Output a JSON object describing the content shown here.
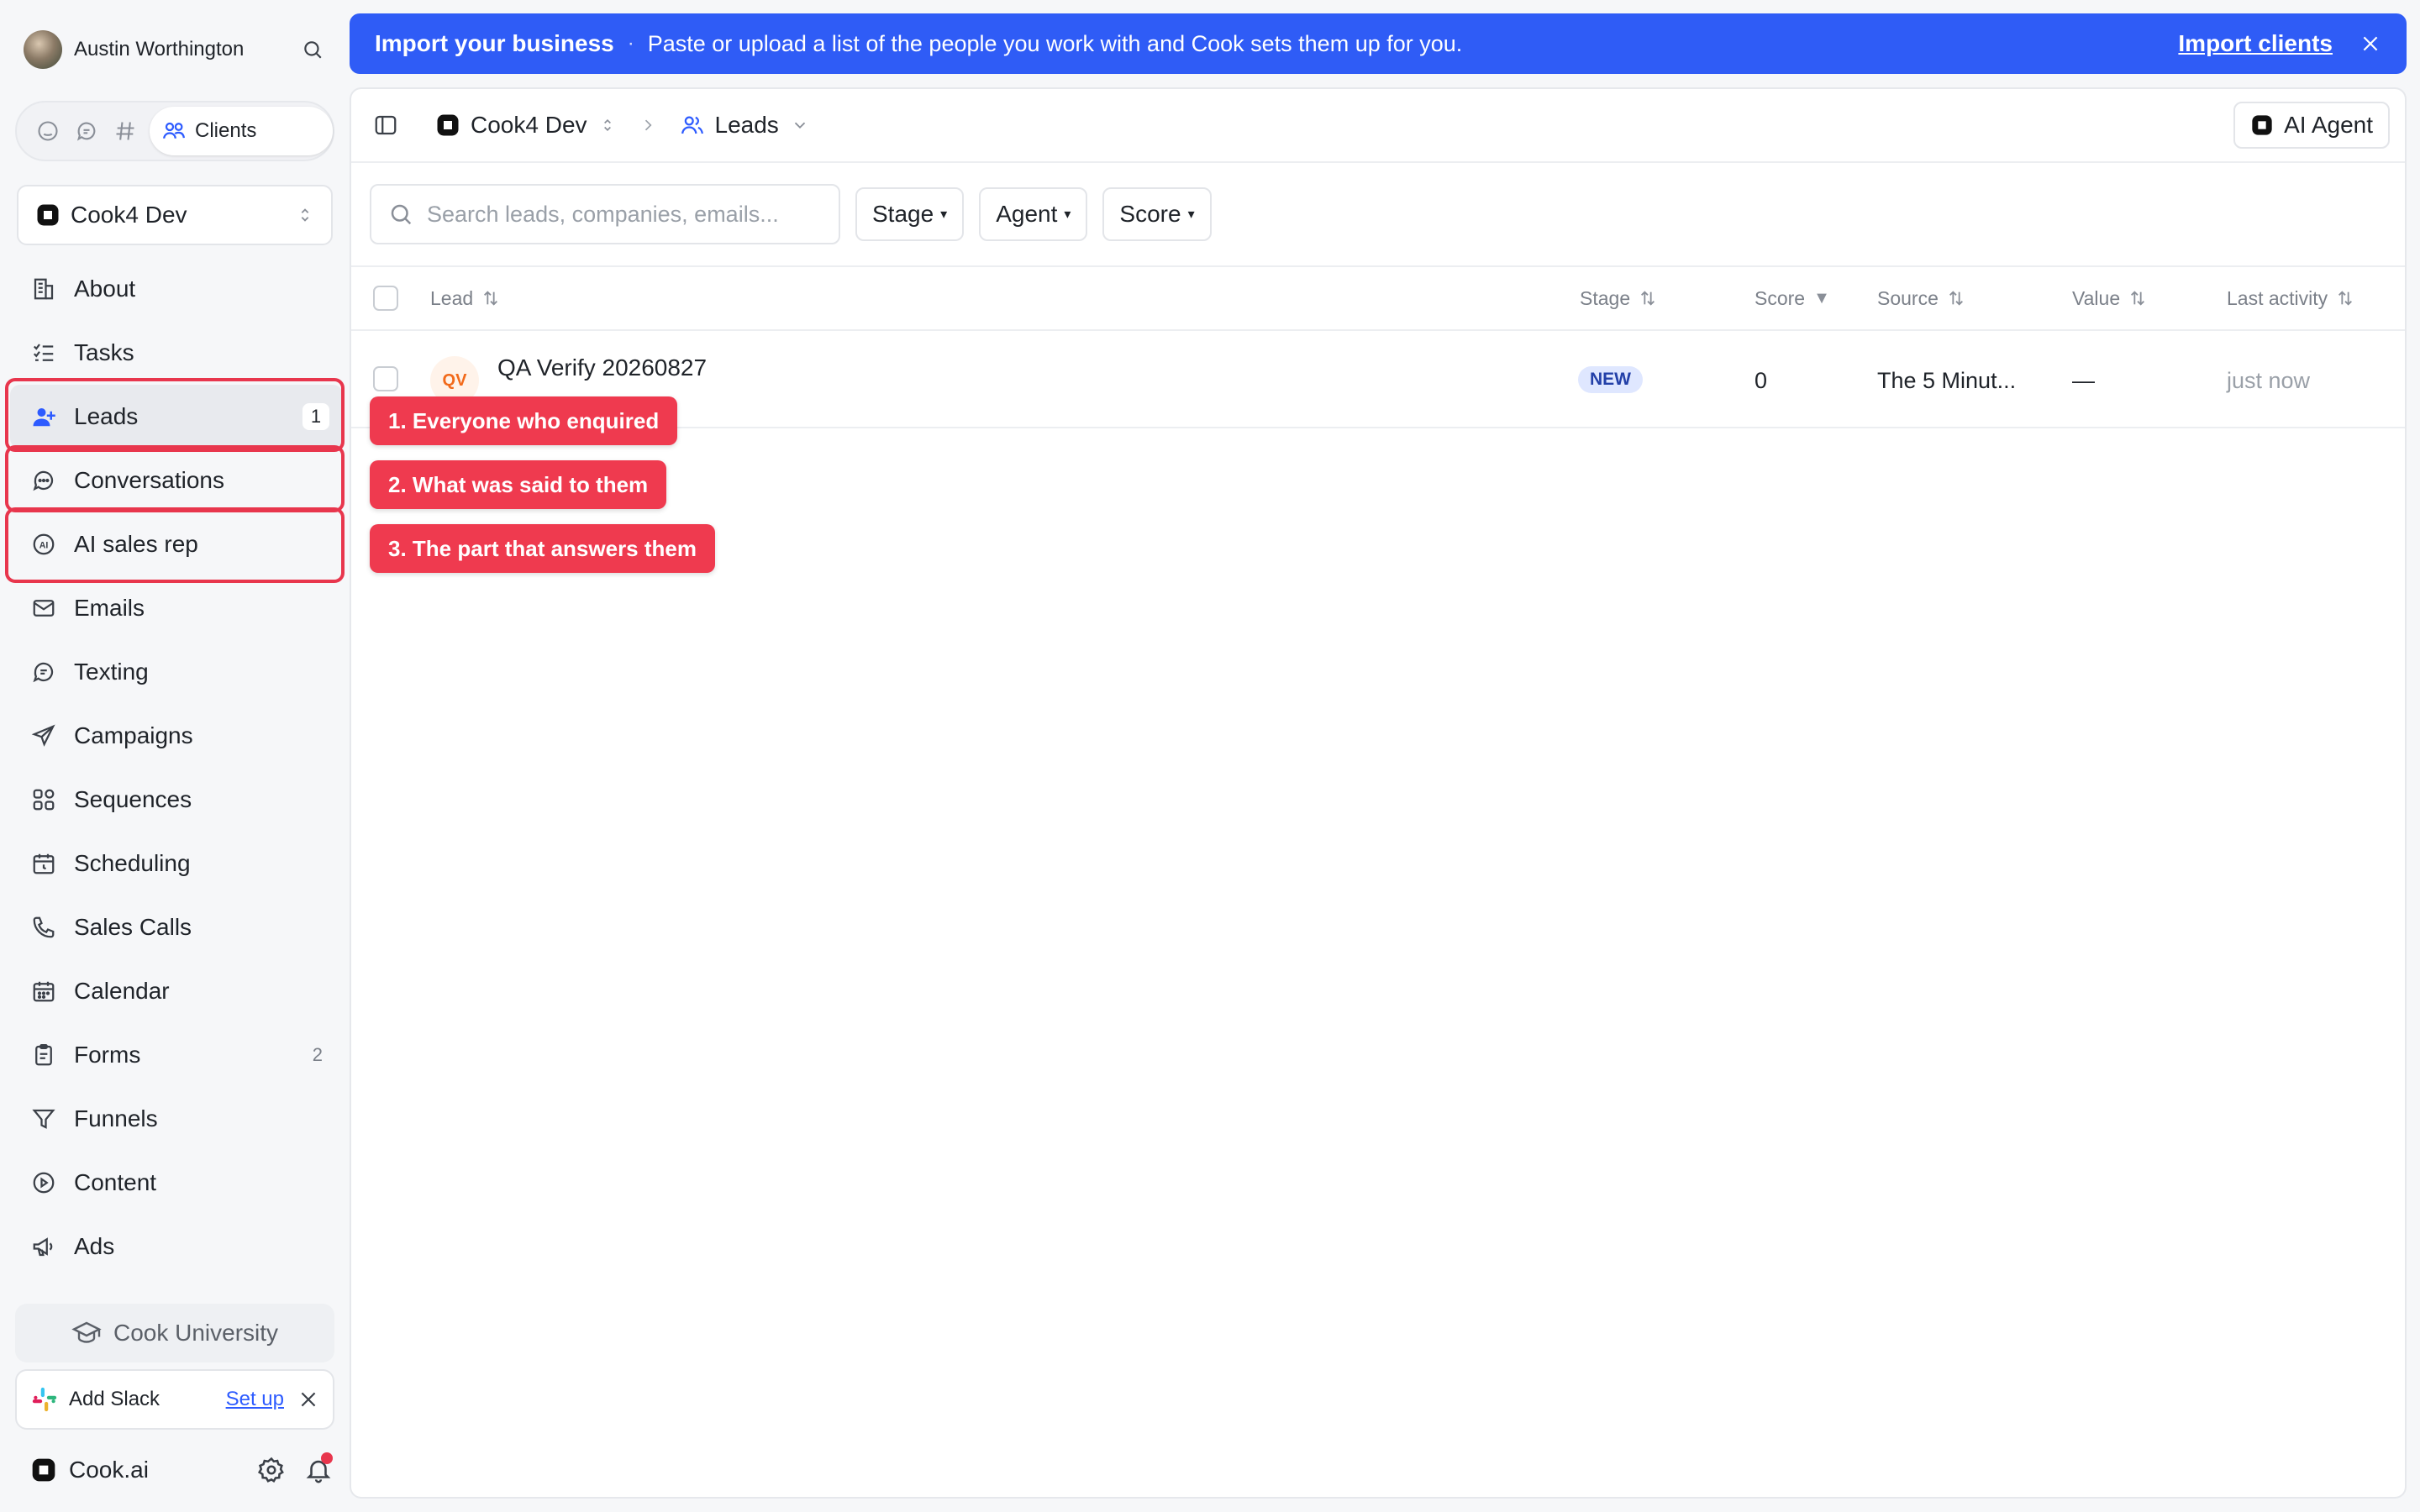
{
  "user": {
    "name": "Austin Worthington"
  },
  "mode_switch": {
    "active_label": "Clients"
  },
  "workspace": {
    "name": "Cook4 Dev"
  },
  "nav": {
    "items": [
      {
        "label": "About",
        "icon": "building-icon"
      },
      {
        "label": "Tasks",
        "icon": "checklist-icon"
      },
      {
        "label": "Leads",
        "icon": "person-plus-icon",
        "count": "1",
        "active": true
      },
      {
        "label": "Conversations",
        "icon": "chat-bubble-icon"
      },
      {
        "label": "AI sales rep",
        "icon": "ai-badge-icon"
      },
      {
        "label": "Emails",
        "icon": "mail-icon"
      },
      {
        "label": "Texting",
        "icon": "message-icon"
      },
      {
        "label": "Campaigns",
        "icon": "send-icon"
      },
      {
        "label": "Sequences",
        "icon": "grid-icon"
      },
      {
        "label": "Scheduling",
        "icon": "calendar-clock-icon"
      },
      {
        "label": "Sales Calls",
        "icon": "phone-icon"
      },
      {
        "label": "Calendar",
        "icon": "calendar-icon"
      },
      {
        "label": "Forms",
        "icon": "clipboard-icon",
        "count": "2"
      },
      {
        "label": "Funnels",
        "icon": "funnel-icon"
      },
      {
        "label": "Content",
        "icon": "play-circle-icon"
      },
      {
        "label": "Ads",
        "icon": "megaphone-icon"
      }
    ]
  },
  "university": {
    "label": "Cook University"
  },
  "slack": {
    "label": "Add Slack",
    "setup_label": "Set up"
  },
  "footer": {
    "brand": "Cook.ai"
  },
  "banner": {
    "title": "Import your business",
    "separator": "·",
    "text": "Paste or upload a list of the people you work with and Cook sets them up for you.",
    "link": "Import clients"
  },
  "breadcrumb": {
    "workspace": "Cook4 Dev",
    "page": "Leads"
  },
  "agent_button": {
    "label": "AI Agent"
  },
  "search": {
    "placeholder": "Search leads, companies, emails..."
  },
  "filters": [
    {
      "label": "Stage"
    },
    {
      "label": "Agent"
    },
    {
      "label": "Score"
    }
  ],
  "table": {
    "columns": [
      "Lead",
      "Stage",
      "Score",
      "Source",
      "Value",
      "Last activity"
    ],
    "rows": [
      {
        "initials": "QV",
        "name": "QA Verify 20260827",
        "subtitle": "—",
        "stage": "NEW",
        "score": "0",
        "source": "The 5 Minut...",
        "value": "—",
        "last_activity": "just now"
      }
    ]
  },
  "annotations": [
    "1. Everyone who enquired",
    "2. What was said to them",
    "3. The part that answers them"
  ],
  "colors": {
    "banner": "#2f5cf6",
    "annotation": "#ef3a4f",
    "stage_new_bg": "#dfe7ff",
    "avatar_accent": "#f26a1b"
  }
}
